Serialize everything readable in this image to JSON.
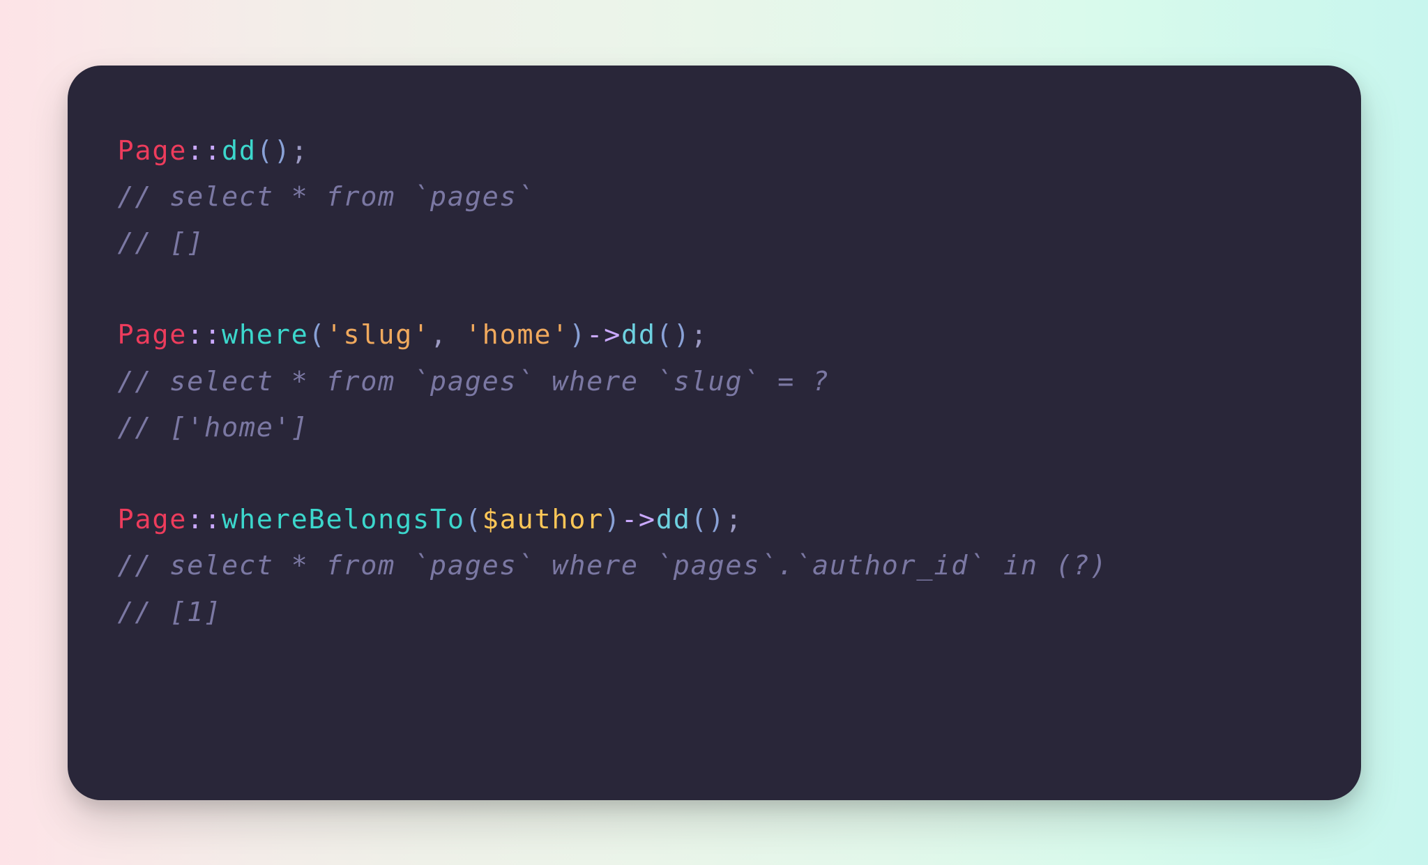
{
  "code": {
    "blocks": [
      {
        "call": {
          "class": "Page",
          "scope": "::",
          "fn1": "dd",
          "paren1_open": "()",
          "rest": ";"
        },
        "comments": [
          "// select * from `pages`",
          "// []"
        ]
      },
      {
        "call": {
          "class": "Page",
          "scope": "::",
          "fn1": "where",
          "paren1_open": "(",
          "args": [
            {
              "type": "string",
              "text": "'slug'"
            },
            {
              "type": "sep",
              "text": ", "
            },
            {
              "type": "string",
              "text": "'home'"
            }
          ],
          "paren1_close": ")",
          "arrow": "->",
          "fn2": "dd",
          "paren2": "()",
          "rest": ";"
        },
        "comments": [
          "// select * from `pages` where `slug` = ?",
          "// ['home']"
        ]
      },
      {
        "call": {
          "class": "Page",
          "scope": "::",
          "fn1": "whereBelongsTo",
          "paren1_open": "(",
          "args": [
            {
              "type": "var",
              "text": "$author"
            }
          ],
          "paren1_close": ")",
          "arrow": "->",
          "fn2": "dd",
          "paren2": "()",
          "rest": ";"
        },
        "comments": [
          "// select * from `pages` where `pages`.`author_id` in (?)",
          "// [1]"
        ]
      }
    ]
  }
}
